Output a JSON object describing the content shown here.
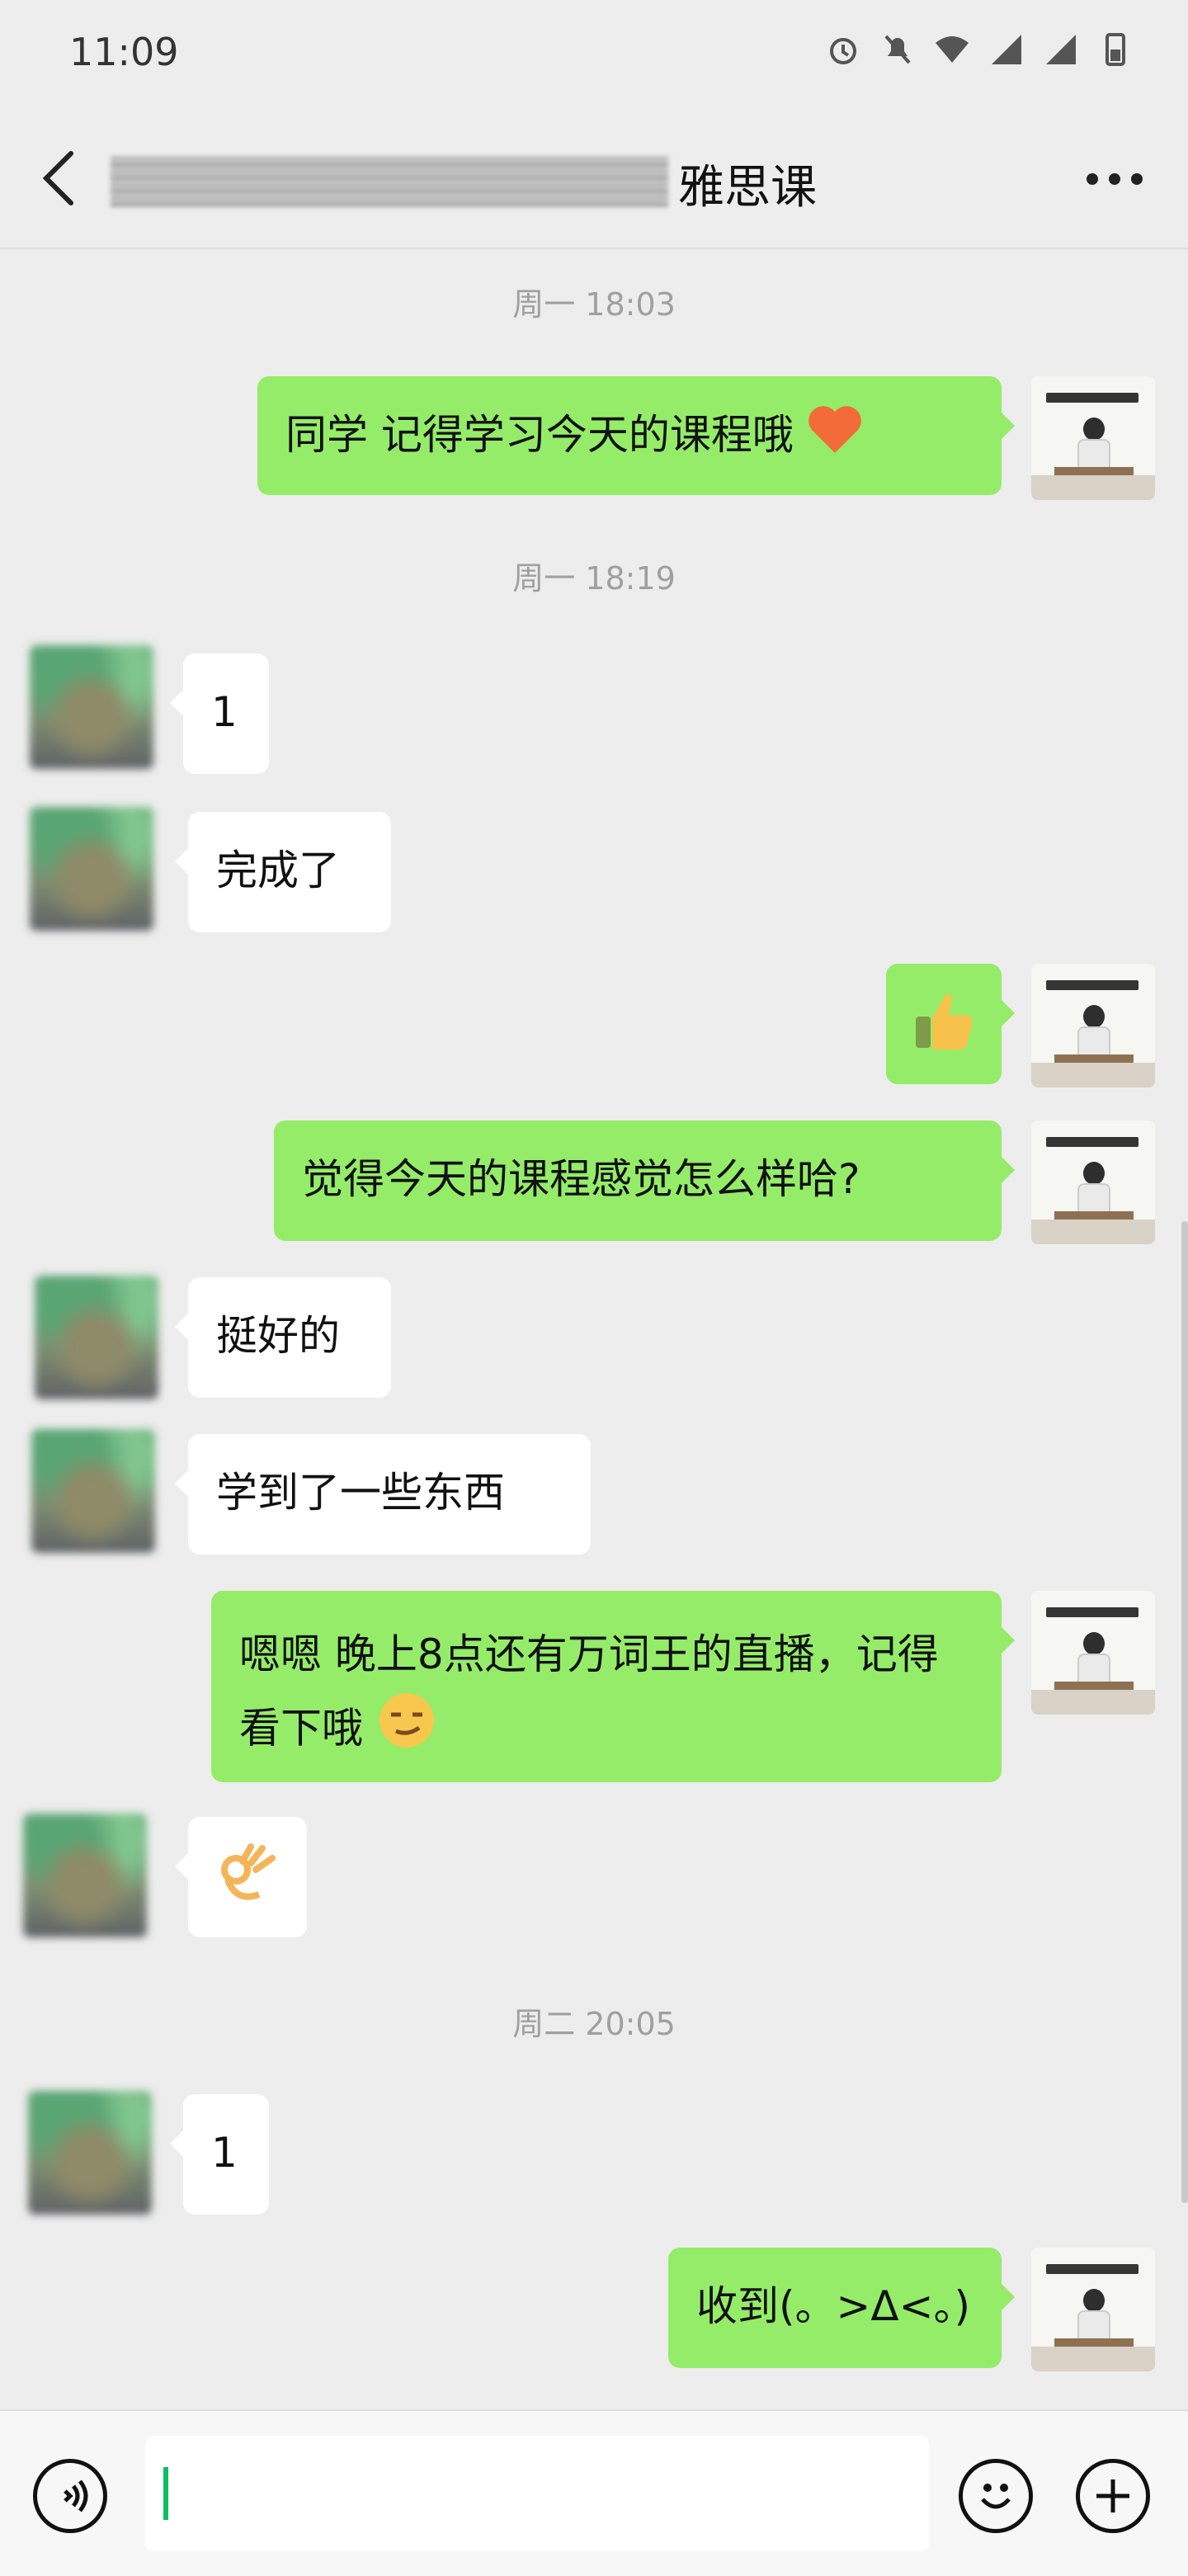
{
  "status_bar": {
    "time": "11:09",
    "icons": [
      "alarm-icon",
      "mute-icon",
      "wifi-icon",
      "signal-icon",
      "signal-icon",
      "battery-icon"
    ]
  },
  "nav": {
    "title": "雅思课",
    "back_icon": "chevron-left-icon",
    "more_icon": "more-dots-icon"
  },
  "messages": [
    {
      "type": "time",
      "text": "周一 18:03"
    },
    {
      "type": "me",
      "text": "同学 记得学习今天的课程哦 "
    },
    {
      "type": "time",
      "text": "周一 18:19"
    },
    {
      "type": "other",
      "text": "1"
    },
    {
      "type": "other",
      "text": "完成了"
    },
    {
      "type": "me",
      "emoji": "thumbs-up"
    },
    {
      "type": "me",
      "text": "觉得今天的课程感觉怎么样哈?"
    },
    {
      "type": "other",
      "text": "挺好的"
    },
    {
      "type": "other",
      "text": "学到了一些东西"
    },
    {
      "type": "me",
      "text": "嗯嗯 晚上8点还有万词王的直播，记得看下哦"
    },
    {
      "type": "other",
      "emoji": "ok-hand"
    },
    {
      "type": "time",
      "text": "周二 20:05"
    },
    {
      "type": "other",
      "text": "1"
    },
    {
      "type": "me",
      "text": "收到(。>Δ<。)"
    }
  ],
  "composer": {
    "voice_icon": "voice-icon",
    "emoji_icon": "smile-icon",
    "plus_icon": "plus-icon"
  }
}
